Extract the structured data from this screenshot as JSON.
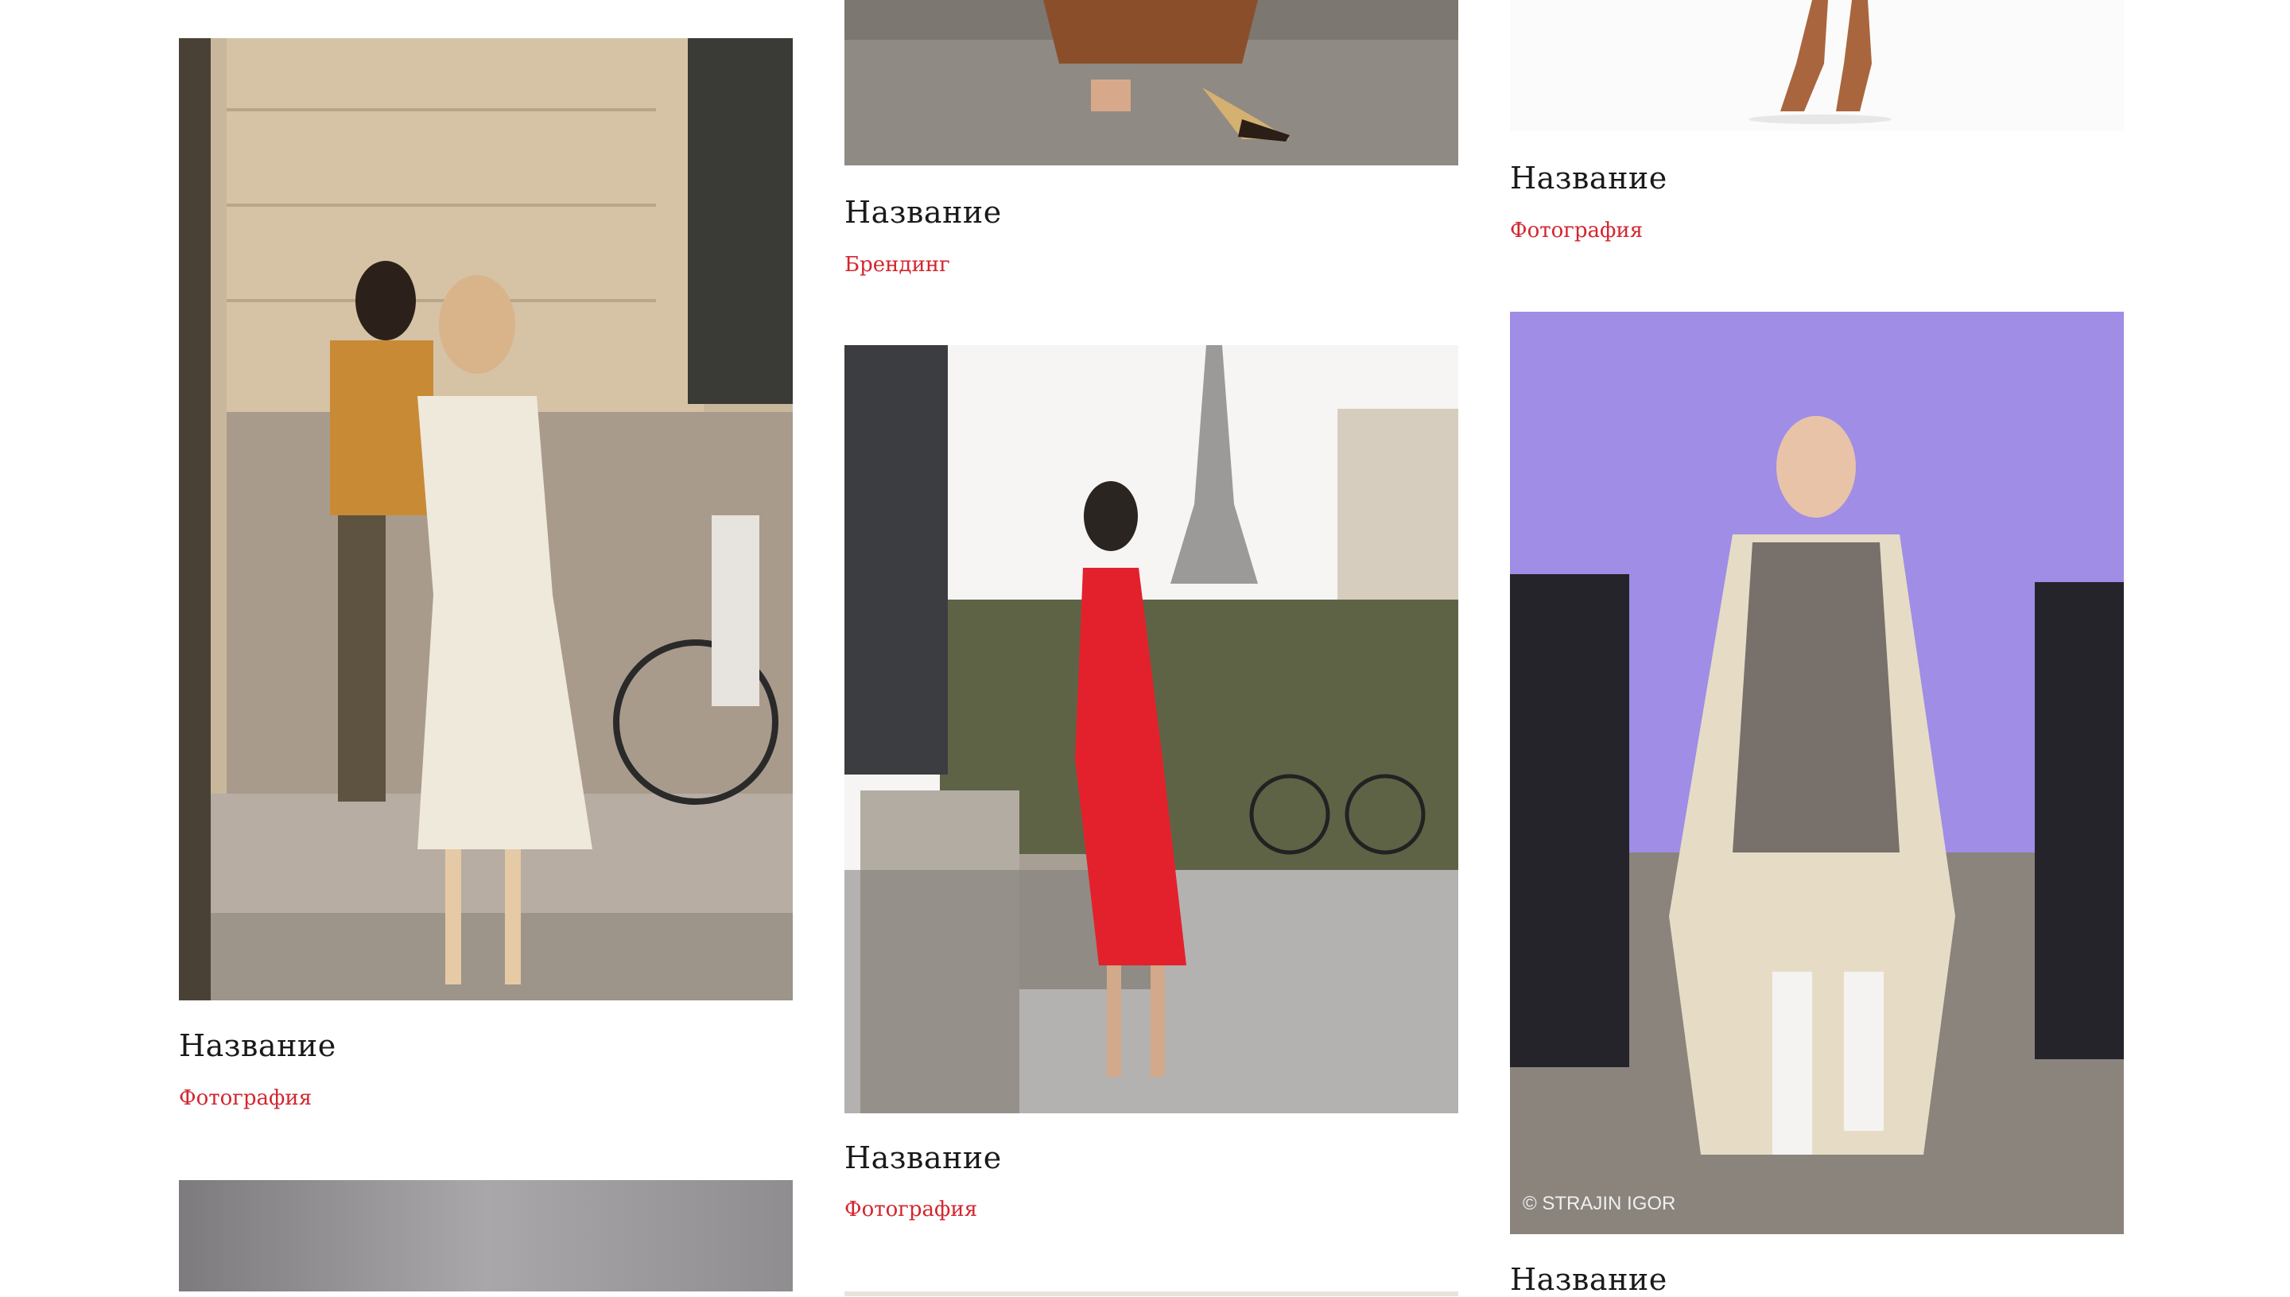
{
  "colors": {
    "category": "#d4262f",
    "title": "#1a1a1a",
    "background": "#ffffff"
  },
  "columns": [
    {
      "cards": [
        {
          "title": "Название",
          "category": "Фотография",
          "image": "woman-in-white-knit-dress-street"
        },
        {
          "title": "",
          "category": "",
          "image": "grey-blurred-photo"
        }
      ]
    },
    {
      "cards": [
        {
          "title": "Название",
          "category": "Брендинг",
          "image": "brown-dress-sandals"
        },
        {
          "title": "Название",
          "category": "Фотография",
          "image": "woman-in-red-dress-paris"
        },
        {
          "title": "",
          "category": "",
          "image": "light-photo"
        }
      ]
    },
    {
      "cards": [
        {
          "title": "Название",
          "category": "Фотография",
          "image": "brown-heels"
        },
        {
          "title": "Название",
          "category": "",
          "image": "runway-model-grey-dress",
          "watermark": "© STRAJIN IGOR"
        }
      ]
    }
  ]
}
